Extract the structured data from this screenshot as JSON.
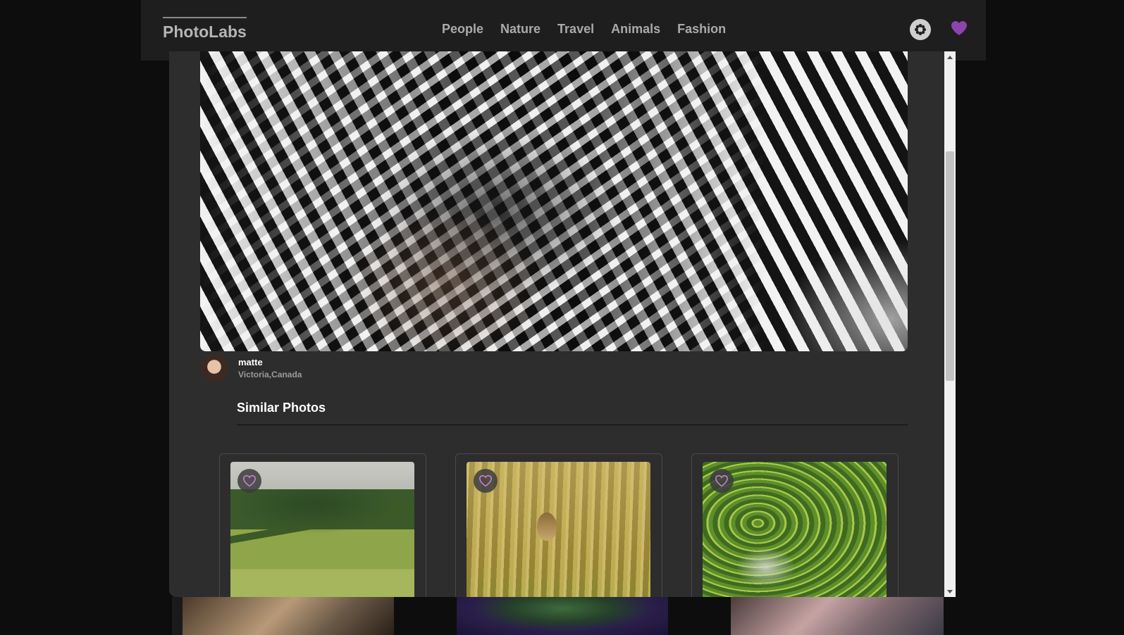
{
  "app": {
    "logo": "PhotoLabs"
  },
  "nav": {
    "topics": [
      "People",
      "Nature",
      "Travel",
      "Animals",
      "Fashion"
    ],
    "icons": {
      "flower": "flower-icon",
      "favourites": "heart-icon"
    }
  },
  "colors": {
    "accent_heart": "#8e44ad",
    "modal_bg": "#2d2d2d",
    "nav_bg": "#1e1e1e"
  },
  "modal": {
    "user": {
      "name": "matte",
      "location": "Victoria,Canada"
    },
    "similar_title": "Similar Photos",
    "similar_photos": [
      {
        "subject": "horses-on-hillside"
      },
      {
        "subject": "bird-in-reeds"
      },
      {
        "subject": "rice-terraces"
      }
    ]
  }
}
